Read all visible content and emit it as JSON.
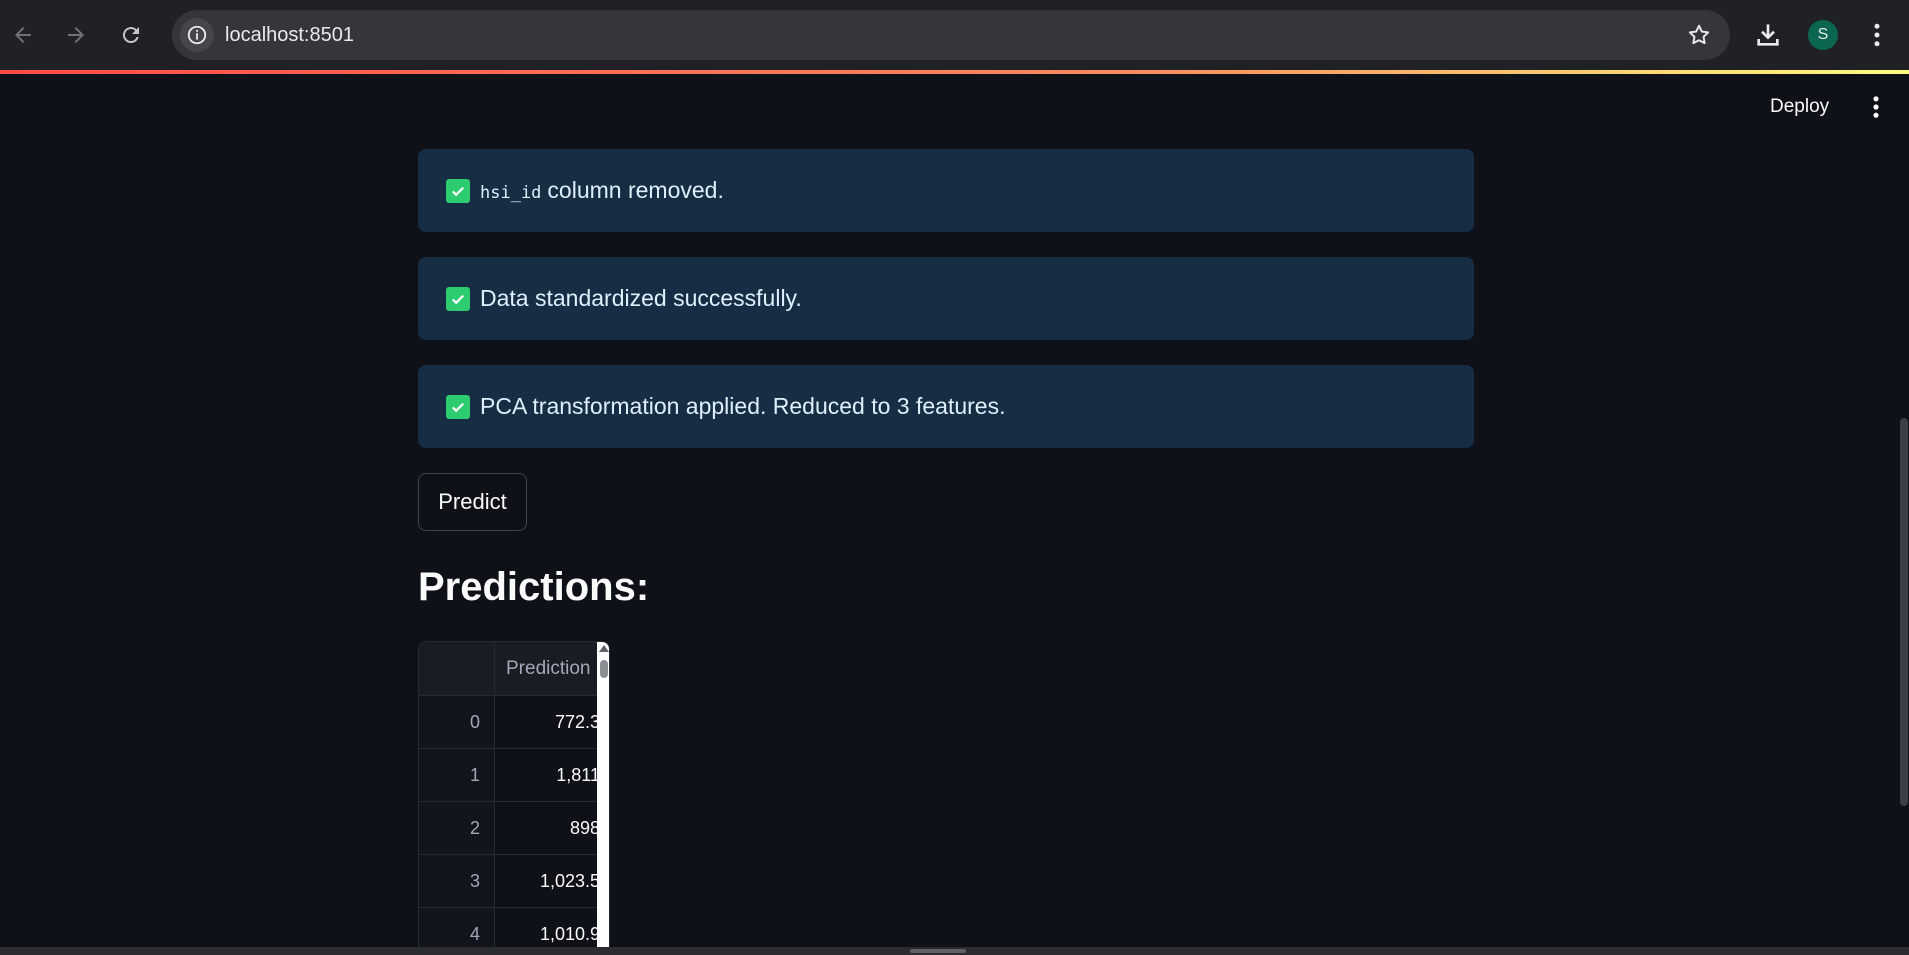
{
  "browser": {
    "url": "localhost:8501",
    "profile_initial": "S"
  },
  "app_header": {
    "deploy_label": "Deploy"
  },
  "alerts": [
    {
      "code": "hsi_id",
      "text": "column removed."
    },
    {
      "text": "Data standardized successfully."
    },
    {
      "text": "PCA transformation applied. Reduced to 3 features."
    }
  ],
  "predict_button": {
    "label": "Predict"
  },
  "predictions": {
    "heading": "Predictions:",
    "column_header": "Prediction",
    "rows": [
      {
        "index": "0",
        "value": "772.3"
      },
      {
        "index": "1",
        "value": "1,811"
      },
      {
        "index": "2",
        "value": "898"
      },
      {
        "index": "3",
        "value": "1,023.5"
      },
      {
        "index": "4",
        "value": "1,010.9"
      }
    ]
  },
  "colors": {
    "success_check": "#2ecc71",
    "alert_bg": "#172d43",
    "page_bg": "#0e1117"
  }
}
